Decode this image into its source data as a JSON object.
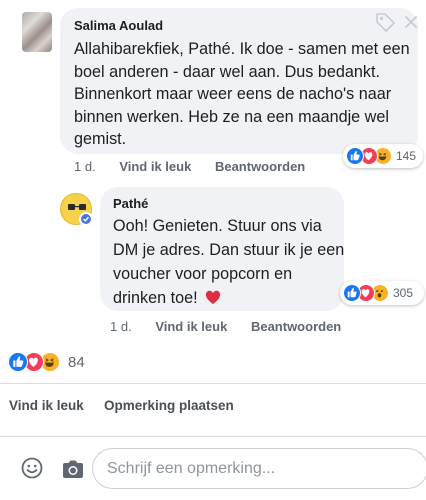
{
  "comment": {
    "author": "Salima Aoulad",
    "text": "Allahibarekfiek, Pathé. Ik doe - samen met een boel anderen - daar wel aan. Dus bedankt.  Binnenkort maar weer eens de nacho's naar binnen werken. Heb ze na een maandje wel gemist.",
    "time": "1 d.",
    "like_label": "Vind ik leuk",
    "reply_label": "Beantwoorden",
    "reaction_count": "145",
    "reactions": [
      "like",
      "love",
      "haha"
    ]
  },
  "reply": {
    "author": "Pathé",
    "text": "Ooh! Genieten. Stuur ons via DM je adres. Dan stuur ik je een voucher voor popcorn en drinken toe!",
    "emoji": "red-heart",
    "time": "1 d.",
    "like_label": "Vind ik leuk",
    "reply_label": "Beantwoorden",
    "reaction_count": "305",
    "reactions": [
      "like",
      "love",
      "wow"
    ]
  },
  "post": {
    "reaction_count": "84",
    "reactions": [
      "like",
      "love",
      "haha"
    ],
    "like_label": "Vind ik leuk",
    "comment_label": "Opmerking plaatsen"
  },
  "composer": {
    "placeholder": "Schrijf een opmerking..."
  },
  "colors": {
    "like": "#1877f2",
    "love": "#f33e58",
    "haha": "#f7b125",
    "bubble": "#f0f2f5",
    "secondary_text": "#606770"
  }
}
